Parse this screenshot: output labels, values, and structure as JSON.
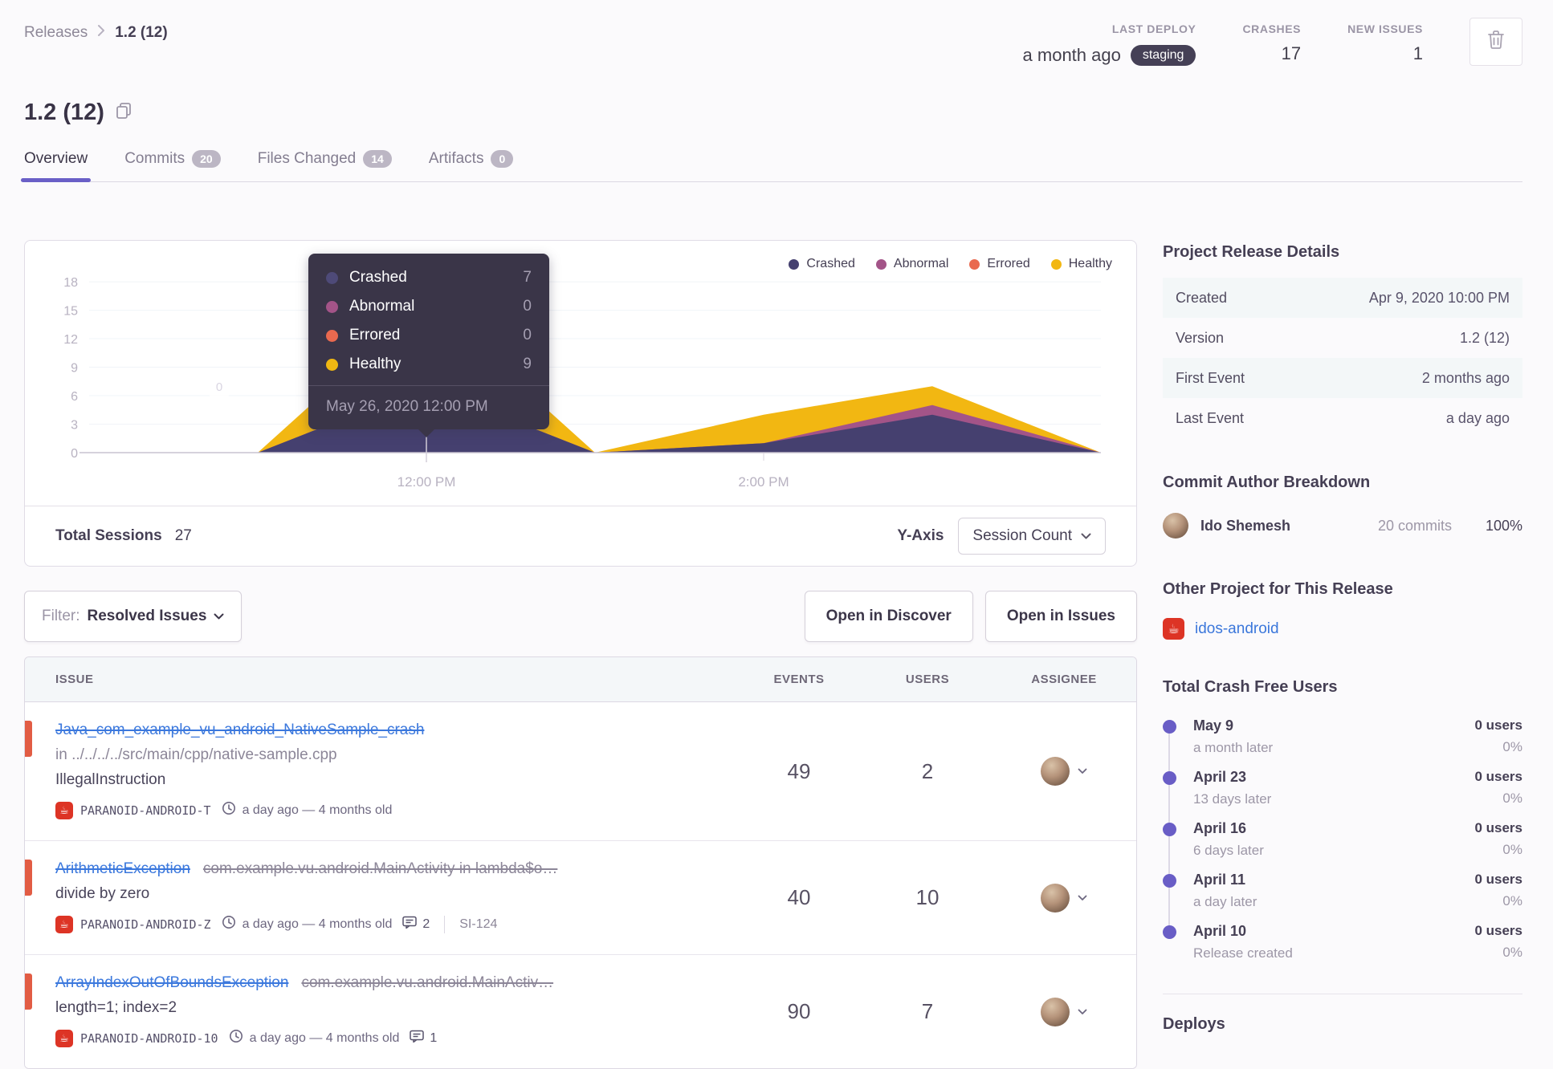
{
  "breadcrumb": {
    "root": "Releases",
    "current": "1.2 (12)"
  },
  "header_stats": {
    "last_deploy_label": "LAST DEPLOY",
    "last_deploy_value": "a month ago",
    "last_deploy_env": "staging",
    "crashes_label": "CRASHES",
    "crashes_value": "17",
    "new_issues_label": "NEW ISSUES",
    "new_issues_value": "1"
  },
  "page_title": "1.2 (12)",
  "tabs": [
    {
      "label": "Overview",
      "active": true
    },
    {
      "label": "Commits",
      "badge": "20"
    },
    {
      "label": "Files Changed",
      "badge": "14"
    },
    {
      "label": "Artifacts",
      "badge": "0"
    }
  ],
  "chart_data": {
    "type": "area",
    "stacked": true,
    "x": [
      "10:00 AM",
      "11:00 AM",
      "12:00 PM",
      "1:00 PM",
      "2:00 PM",
      "3:00 PM",
      "4:00 PM"
    ],
    "x_tick_labels": [
      {
        "label": "12:00 PM",
        "index": 2
      },
      {
        "label": "2:00 PM",
        "index": 4
      }
    ],
    "y_ticks": [
      0,
      3,
      6,
      9,
      12,
      15,
      18
    ],
    "ylim": [
      0,
      18
    ],
    "grid": true,
    "legend_position": "top-right",
    "series": [
      {
        "name": "Crashed",
        "color": "#45406f",
        "values": [
          0,
          0,
          7,
          0,
          1,
          4,
          0
        ]
      },
      {
        "name": "Abnormal",
        "color": "#a35488",
        "values": [
          0,
          0,
          0,
          0,
          0,
          1,
          0
        ]
      },
      {
        "name": "Errored",
        "color": "#e9694f",
        "values": [
          0,
          0,
          0,
          0,
          0,
          0,
          0
        ]
      },
      {
        "name": "Healthy",
        "color": "#f2b712",
        "values": [
          0,
          0,
          9,
          0,
          3,
          2,
          0
        ]
      }
    ],
    "zero_label": "0"
  },
  "chart_tooltip": {
    "rows": [
      {
        "label": "Crashed",
        "value": "7",
        "color": "#4e4a78"
      },
      {
        "label": "Abnormal",
        "value": "0",
        "color": "#a35488"
      },
      {
        "label": "Errored",
        "value": "0",
        "color": "#e9694f"
      },
      {
        "label": "Healthy",
        "value": "9",
        "color": "#efb712"
      }
    ],
    "date": "May 26, 2020 12:00 PM"
  },
  "sessions_footer": {
    "label": "Total Sessions",
    "value": "27",
    "axis_label": "Y-Axis",
    "axis_value": "Session Count"
  },
  "filter_bar": {
    "filter_prefix": "Filter:",
    "filter_value": "Resolved Issues",
    "discover_button": "Open in Discover",
    "issues_button": "Open in Issues"
  },
  "issues_table": {
    "columns": [
      "ISSUE",
      "EVENTS",
      "USERS",
      "ASSIGNEE"
    ],
    "rows": [
      {
        "title": "Java_com_example_vu_android_NativeSample_crash",
        "location": "in ../../../../src/main/cpp/native-sample.cpp",
        "description": "IllegalInstruction",
        "project": "PARANOID-ANDROID-T",
        "age": "a day ago — 4 months old",
        "events": "49",
        "users": "2"
      },
      {
        "title": "ArithmeticException",
        "subtitle": "com.example.vu.android.MainActivity in lambda$o…",
        "description": "divide by zero",
        "project": "PARANOID-ANDROID-Z",
        "age": "a day ago — 4 months old",
        "comments": "2",
        "link": "SI-124",
        "events": "40",
        "users": "10"
      },
      {
        "title": "ArrayIndexOutOfBoundsException",
        "subtitle": "com.example.vu.android.MainActiv…",
        "description": "length=1; index=2",
        "project": "PARANOID-ANDROID-10",
        "age": "a day ago — 4 months old",
        "comments": "1",
        "events": "90",
        "users": "7"
      }
    ]
  },
  "sidebar": {
    "release_details": {
      "heading": "Project Release Details",
      "rows": [
        {
          "label": "Created",
          "value": "Apr 9, 2020 10:00 PM",
          "striped": true
        },
        {
          "label": "Version",
          "value": "1.2 (12)"
        },
        {
          "label": "First Event",
          "value": "2 months ago",
          "striped": true
        },
        {
          "label": "Last Event",
          "value": "a day ago"
        }
      ]
    },
    "commit_authors": {
      "heading": "Commit Author Breakdown",
      "author": "Ido Shemesh",
      "commits": "20 commits",
      "percent": "100%"
    },
    "other_project": {
      "heading": "Other Project for This Release",
      "project": "idos-android"
    },
    "crash_free": {
      "heading": "Total Crash Free Users",
      "items": [
        {
          "date": "May 9",
          "note": "a month later",
          "users": "0 users",
          "percent": "0%"
        },
        {
          "date": "April 23",
          "note": "13 days later",
          "users": "0 users",
          "percent": "0%"
        },
        {
          "date": "April 16",
          "note": "6 days later",
          "users": "0 users",
          "percent": "0%"
        },
        {
          "date": "April 11",
          "note": "a day later",
          "users": "0 users",
          "percent": "0%"
        },
        {
          "date": "April 10",
          "note": "Release created",
          "users": "0 users",
          "percent": "0%"
        }
      ]
    },
    "deploys_heading": "Deploys"
  },
  "colors": {
    "accent_purple": "#6a5fc7",
    "link_blue": "#3b77db",
    "error_red": "#e25c44",
    "staging_pill_bg": "#454056",
    "crashed": "#45406f",
    "abnormal": "#a35488",
    "errored": "#e9694f",
    "healthy": "#f2b712"
  },
  "icons": {
    "coffee_project_icon": "☕"
  }
}
